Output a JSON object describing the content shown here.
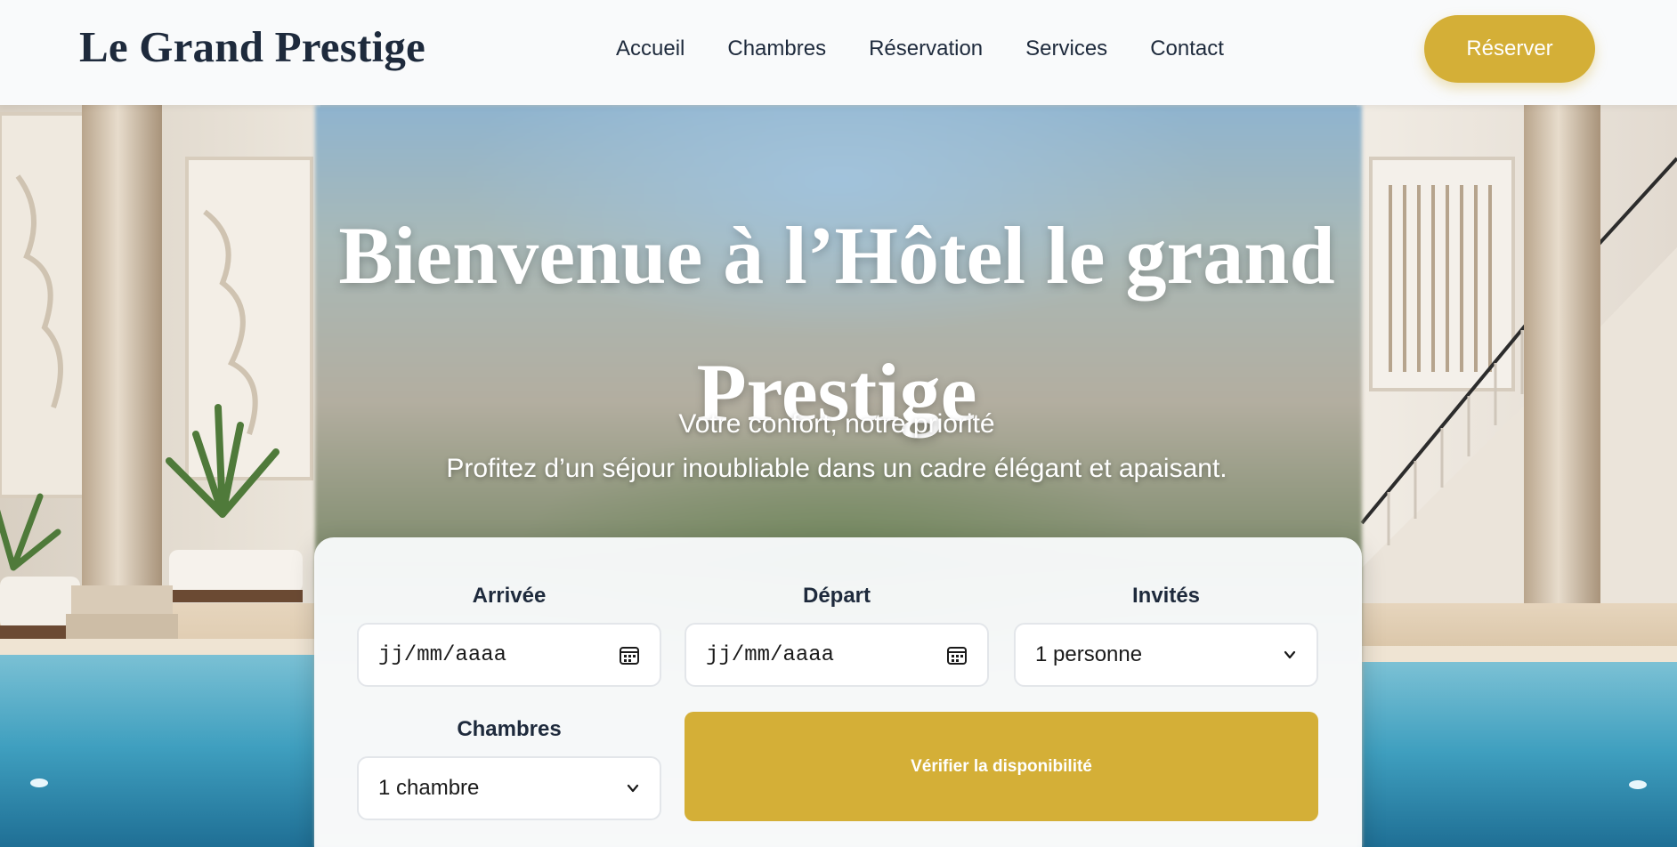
{
  "brand": {
    "name": "Le Grand Prestige"
  },
  "nav": {
    "items": [
      {
        "label": "Accueil"
      },
      {
        "label": "Chambres"
      },
      {
        "label": "Réservation"
      },
      {
        "label": "Services"
      },
      {
        "label": "Contact"
      }
    ],
    "cta_label": "Réserver"
  },
  "hero": {
    "title": "Bienvenue à l’Hôtel le grand Prestige",
    "tagline": "Votre confort, notre priorité",
    "subtitle": "Profitez d’un séjour inoubliable dans un cadre élégant et apaisant."
  },
  "booking": {
    "arrival": {
      "label": "Arrivée",
      "placeholder": "jj/mm/aaaa",
      "icon": "calendar-icon"
    },
    "departure": {
      "label": "Départ",
      "placeholder": "jj/mm/aaaa",
      "icon": "calendar-icon"
    },
    "guests": {
      "label": "Invités",
      "selected": "1 personne",
      "icon": "chevron-down-icon"
    },
    "rooms": {
      "label": "Chambres",
      "selected": "1 chambre",
      "icon": "chevron-down-icon"
    },
    "submit_label": "Vérifier la disponibilité"
  },
  "colors": {
    "accent": "#d4af37",
    "text_dark": "#1e2a3c",
    "header_bg": "#f9fafb",
    "pool_water": "#4aa9c6"
  }
}
